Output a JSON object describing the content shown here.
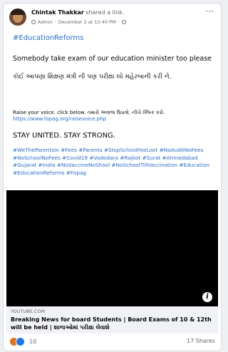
{
  "post": {
    "author": "Chintak Thakkar",
    "action": "shared a link.",
    "role": "Admin",
    "separator": "·",
    "date": "December 2 at 12:40 PM",
    "meta_dot": "·",
    "more_label": "···",
    "hashtag_head": "#EducationReforms",
    "main_english": "Somebody take exam of our education minister too please",
    "main_gujarati": "કોઈ આપણા શિક્ષણ મંત્રી ની પણ પરીક્ષા લો મહેરબાની કરી ને.",
    "raise_text": "Raise your voice. click below. તમારો અવાજ ઉઠાવો. નીચે ક્લિક કરો.",
    "raise_link": "https://www.fopag.org/raisevoice.php",
    "stay_text": "STAY UNITED. STAY STRONG.",
    "tags": "#WeTheParentsIn #Fees #Parents #StopSchoolFeeLoot #NoAuditNoFees #NoSchoolNoFees #Covid19 #Vadodara #Rajkot #Surat #Ahmedabad #Gujarat #India #NoVaccineNoShool #NoSchoolTillVaccination #Education #EducationReforms #Fopag"
  },
  "link_preview": {
    "domain": "YOUTUBE.COM",
    "title": "Breaking News for board Students | Board Exams of 10 & 12th will be held | શાળાઓમાં પરીક્ષા લેવાશે",
    "info_label": "i"
  },
  "footer": {
    "reaction_count": "10",
    "shares": "17 Shares"
  },
  "colors": {
    "link": "#216fdb",
    "angry": "#e9710f",
    "like": "#1877f2"
  }
}
